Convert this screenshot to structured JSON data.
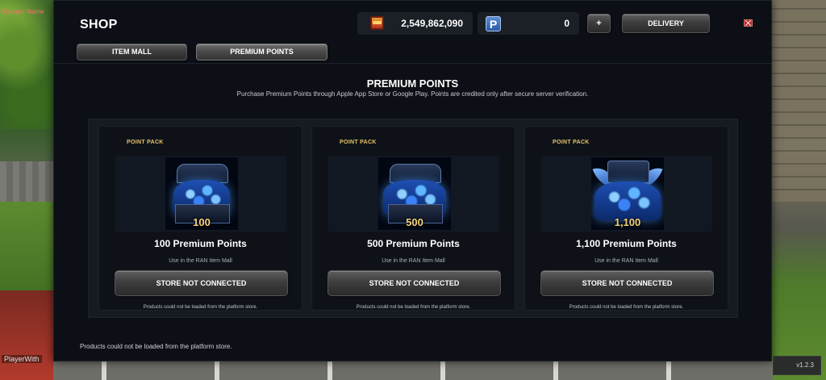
{
  "world": {
    "top_label": "Monster Name",
    "player_label": "PlayerWith"
  },
  "shop": {
    "title": "SHOP",
    "gold_amount": "2,549,862,090",
    "points_amount": "0",
    "plus_label": "+",
    "delivery_label": "DELIVERY",
    "tabs": [
      {
        "label": "ITEM MALL",
        "active": false
      },
      {
        "label": "PREMIUM POINTS",
        "active": true
      }
    ],
    "section_title": "PREMIUM POINTS",
    "section_subtitle": "Purchase Premium Points through Apple App Store or Google Play. Points are credited only after secure server verification.",
    "cards": [
      {
        "pack_label": "POINT PACK",
        "qty": "100",
        "name": "100 Premium Points",
        "desc": "Use in the RAN Item Mall",
        "button": "STORE NOT CONNECTED",
        "note": "Products could not be loaded from the platform store."
      },
      {
        "pack_label": "POINT PACK",
        "qty": "500",
        "name": "500 Premium Points",
        "desc": "Use in the RAN Item Mall",
        "button": "STORE NOT CONNECTED",
        "note": "Products could not be loaded from the platform store."
      },
      {
        "pack_label": "POINT PACK",
        "qty": "1,100",
        "name": "1,100 Premium Points",
        "desc": "Use in the RAN Item Mall",
        "button": "STORE NOT CONNECTED",
        "note": "Products could not be loaded from the platform store."
      }
    ],
    "footer_note": "Products could not be loaded from the platform store."
  },
  "version": "v1.2.3",
  "colors": {
    "panel_bg": "#0c0f15",
    "pack_label": "#e8c46a",
    "close_red": "#b52a2a"
  }
}
